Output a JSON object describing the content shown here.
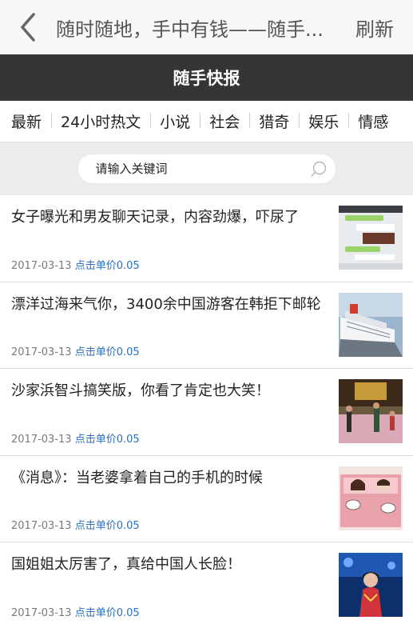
{
  "header": {
    "back_icon": "chevron-left-icon",
    "title": "随时随地，手中有钱——随手...",
    "refresh_label": "刷新"
  },
  "brand": {
    "title": "随手快报"
  },
  "tabs": [
    "最新",
    "24小时热文",
    "小说",
    "社会",
    "猎奇",
    "娱乐",
    "情感"
  ],
  "search": {
    "placeholder": "请输入关键词",
    "icon": "search-icon"
  },
  "articles": [
    {
      "title": "女子曝光和男友聊天记录，内容劲爆，吓尿了",
      "date": "2017-03-13",
      "price_label": "点击单价0.05",
      "thumb": "chat-screenshot-thumbnail"
    },
    {
      "title": "漂洋过海来气你，3400余中国游客在韩拒下邮轮",
      "date": "2017-03-13",
      "price_label": "点击单价0.05",
      "thumb": "cruise-ship-thumbnail"
    },
    {
      "title": "沙家浜智斗搞笑版，你看了肯定也大笑！",
      "date": "2017-03-13",
      "price_label": "点击单价0.05",
      "thumb": "stage-performance-thumbnail"
    },
    {
      "title": "《消息》：当老婆拿着自己的手机的时候",
      "date": "2017-03-13",
      "price_label": "点击单价0.05",
      "thumb": "couple-cartoon-thumbnail"
    },
    {
      "title": "国姐姐太厉害了，真给中国人长脸！",
      "date": "2017-03-13",
      "price_label": "点击单价0.05",
      "thumb": "singer-stage-thumbnail"
    }
  ],
  "colors": {
    "brand_bar": "#353537",
    "price_link": "#2a6fbf",
    "search_bg": "#ececec"
  }
}
